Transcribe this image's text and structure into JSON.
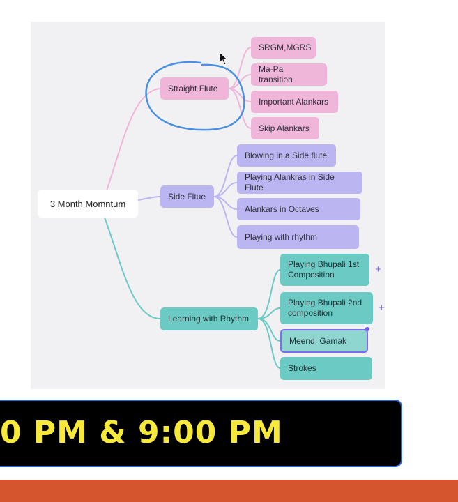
{
  "mindmap": {
    "root": "3 Month Momntum",
    "branches": [
      {
        "label": "Straight Flute",
        "color": "#f0b6d9",
        "children": [
          "SRGM,MGRS",
          "Ma-Pa transition",
          "Important Alankars",
          "Skip Alankars"
        ]
      },
      {
        "label": "Side Fltue",
        "color": "#bbb5f1",
        "children": [
          "Blowing in a Side flute",
          "Playing Alankras in Side Flute",
          "Alankars in Octaves",
          "Playing with rhythm"
        ]
      },
      {
        "label": "Learning with Rhythm",
        "color": "#6ccac4",
        "children": [
          "Playing Bhupali 1st Composition",
          "Playing Bhupali 2nd composition",
          "Meend, Gamak",
          "Strokes"
        ]
      }
    ],
    "expand_symbol": "+"
  },
  "banner": {
    "text": "0 PM & 9:00 PM",
    "text_color": "#f6e93a",
    "background": "#000000",
    "border_color": "#2a64c8"
  },
  "annotation": {
    "circle_color": "#4a90e2"
  },
  "icons": {
    "cursor": "mouse-pointer-icon"
  },
  "colors": {
    "bottom_stripe": "#d4552e",
    "canvas": "#f1f1f3"
  }
}
